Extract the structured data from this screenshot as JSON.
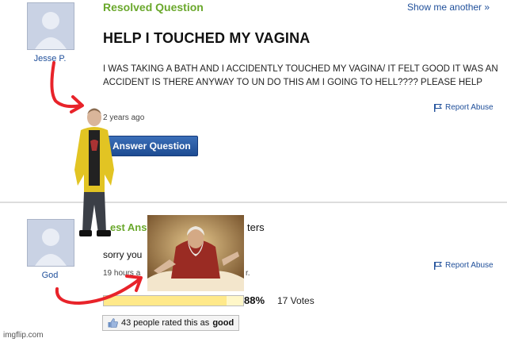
{
  "question": {
    "status": "Resolved Question",
    "show_another": "Show me another »",
    "title": "HELP I TOUCHED MY VAGINA",
    "body": "I WAS TAKING A BATH AND I ACCIDENTLY TOUCHED MY VAGINA/ IT FELT GOOD IT WAS AN ACCIDENT IS THERE ANYWAY TO UN DO THIS AM I GOING TO HELL???? PLEASE HELP",
    "asker": "Jesse P.",
    "timestamp": "2 years ago",
    "report_label": "Report Abuse",
    "answer_button": "Answer Question"
  },
  "answer": {
    "best_label_prefix": "est Ans",
    "best_label_suffix": "ters",
    "answerer": "God",
    "text_visible": "sorry you",
    "timestamp_prefix": "19 hours a",
    "timestamp_suffix": "r.",
    "report_label": "Report Abuse",
    "rating_percent": "88%",
    "rating_fraction": 0.88,
    "votes": "17 Votes",
    "rated_count": "43 people rated this as",
    "rated_word": "good"
  },
  "watermark": "imgflip.com",
  "colors": {
    "accent_green": "#6aa82c",
    "link_blue": "#1f4f9a",
    "arrow_red": "#e8232a"
  },
  "icons": {
    "flag": "flag-icon",
    "thumb": "thumbs-up-icon",
    "avatar": "default-avatar-icon"
  }
}
